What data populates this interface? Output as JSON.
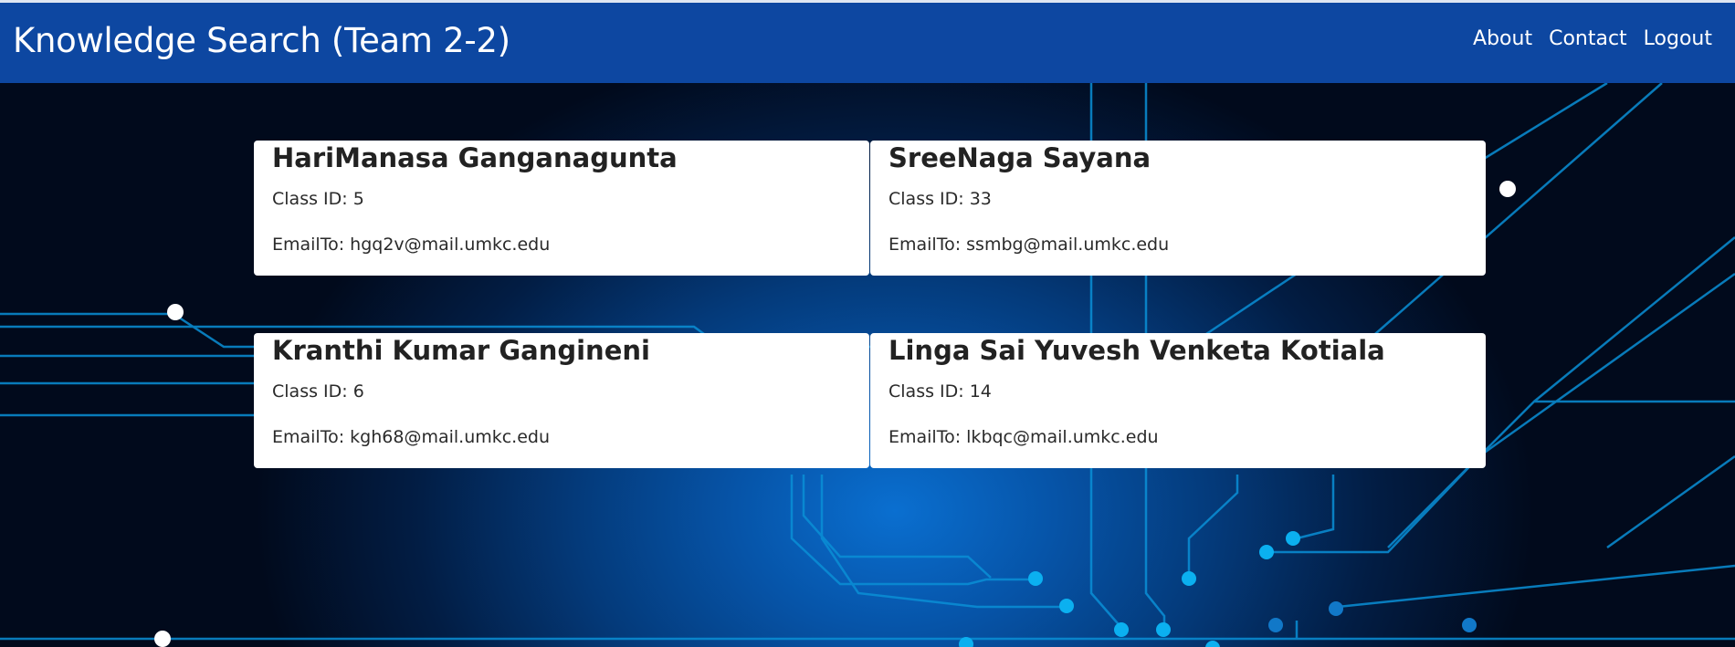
{
  "header": {
    "title": "Knowledge Search (Team 2-2)",
    "links": [
      "About",
      "Contact",
      "Logout"
    ]
  },
  "members": [
    {
      "name": "HariManasa Ganganagunta",
      "class_id": "Class ID: 5",
      "email": "EmailTo: hgq2v@mail.umkc.edu"
    },
    {
      "name": "SreeNaga Sayana",
      "class_id": "Class ID: 33",
      "email": "EmailTo: ssmbg@mail.umkc.edu"
    },
    {
      "name": "Kranthi Kumar Gangineni",
      "class_id": "Class ID: 6",
      "email": "EmailTo: kgh68@mail.umkc.edu"
    },
    {
      "name": "Linga Sai Yuvesh Venketa Kotiala",
      "class_id": "Class ID: 14",
      "email": "EmailTo: lkbqc@mail.umkc.edu"
    }
  ],
  "colors": {
    "navbar": "#0d47a1",
    "circuit": "#0aa3e8"
  },
  "background": "circuit-board-image"
}
